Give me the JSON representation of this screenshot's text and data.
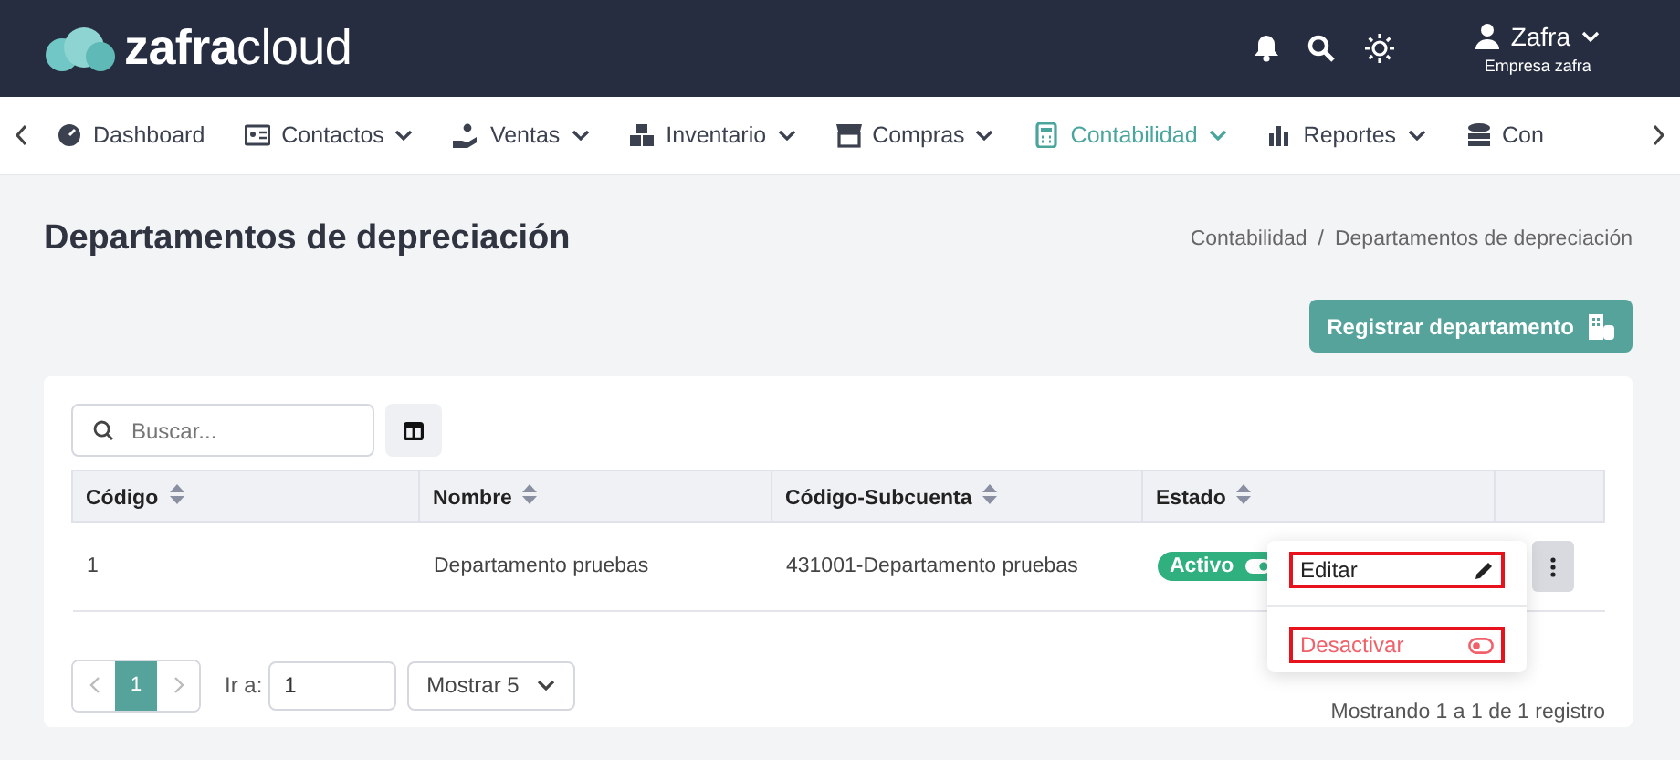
{
  "header": {
    "logo_parts": [
      "zafra",
      "cloud"
    ],
    "user": {
      "name": "Zafra",
      "company": "Empresa zafra"
    }
  },
  "nav": {
    "items": [
      {
        "label": "Dashboard",
        "selected": false,
        "dropdown": false
      },
      {
        "label": "Contactos",
        "selected": false,
        "dropdown": true
      },
      {
        "label": "Ventas",
        "selected": false,
        "dropdown": true
      },
      {
        "label": "Inventario",
        "selected": false,
        "dropdown": true
      },
      {
        "label": "Compras",
        "selected": false,
        "dropdown": true
      },
      {
        "label": "Contabilidad",
        "selected": true,
        "dropdown": true
      },
      {
        "label": "Reportes",
        "selected": false,
        "dropdown": true
      },
      {
        "label": "Con",
        "selected": false,
        "dropdown": false
      }
    ]
  },
  "page": {
    "title": "Departamentos de depreciación",
    "breadcrumb": [
      "Contabilidad",
      "Departamentos de depreciación"
    ],
    "breadcrumb_separator": "/",
    "primary_button": "Registrar departamento"
  },
  "table": {
    "search": {
      "placeholder": "Buscar..."
    },
    "columns": [
      "Código",
      "Nombre",
      "Código-Subcuenta",
      "Estado"
    ],
    "rows": [
      {
        "cells": [
          "1",
          "Departamento pruebas",
          "431001-Departamento pruebas"
        ],
        "status": "Activo",
        "active": true
      }
    ],
    "row_menu": [
      {
        "label": "Editar",
        "kind": "edit",
        "outlined": true
      },
      {
        "label": "Desactivar",
        "kind": "deactivate",
        "outlined": true
      }
    ]
  },
  "pagination": {
    "pages": [
      {
        "label": "1",
        "selected": true
      }
    ],
    "goto_label": "Ir a:",
    "goto_value": "1",
    "page_size": "Mostrar 5",
    "summary": "Mostrando 1 a 1 de 1 registro"
  }
}
